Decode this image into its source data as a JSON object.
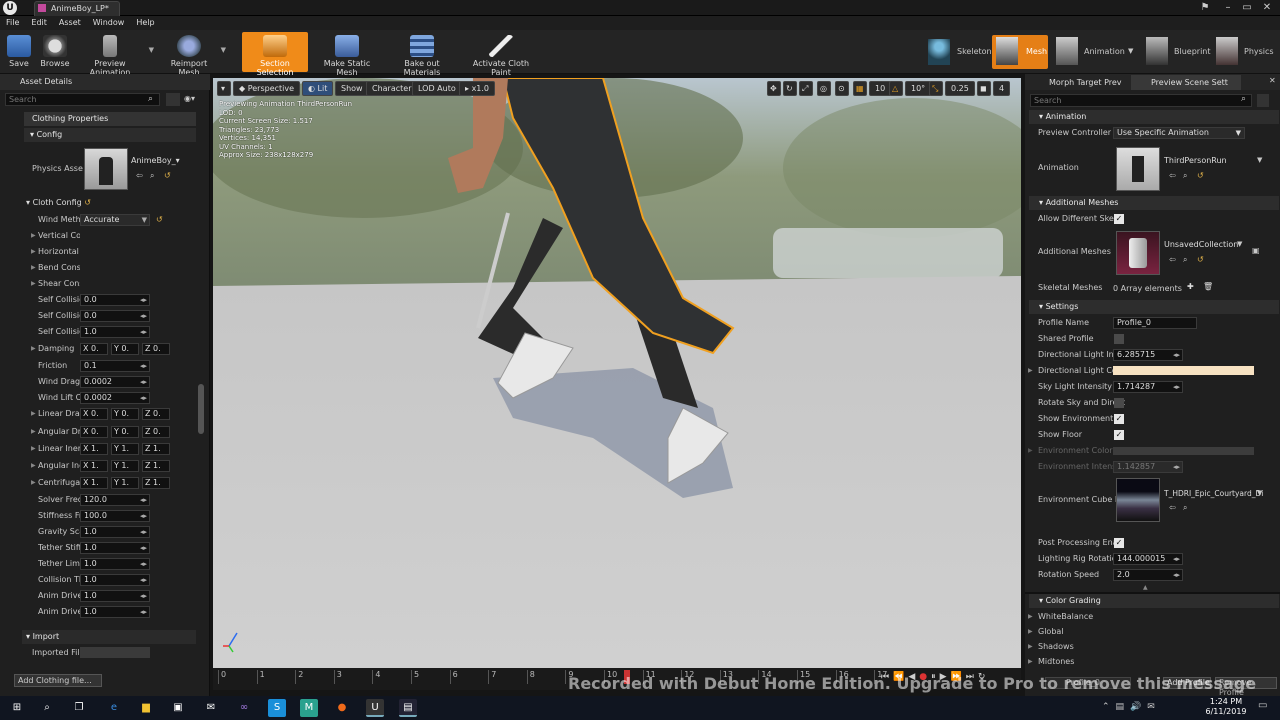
{
  "window": {
    "tab_title": "AnimeBoy_LP*"
  },
  "menu": [
    "File",
    "Edit",
    "Asset",
    "Window",
    "Help"
  ],
  "toolbar": [
    {
      "label": "Save",
      "icon": "save-icon"
    },
    {
      "label": "Browse",
      "icon": "browse-icon"
    },
    {
      "label": "Preview Animation",
      "icon": "preview-animation-icon"
    },
    {
      "label": "Reimport Mesh",
      "icon": "reimport-icon"
    },
    {
      "label": "Section Selection",
      "icon": "section-selection-icon"
    },
    {
      "label": "Make Static Mesh",
      "icon": "static-mesh-icon"
    },
    {
      "label": "Bake out Materials",
      "icon": "bake-materials-icon"
    },
    {
      "label": "Activate Cloth Paint",
      "icon": "cloth-paint-icon"
    }
  ],
  "modes": [
    "Skeleton",
    "Mesh",
    "Animation",
    "Blueprint",
    "Physics"
  ],
  "left": {
    "title": "Asset Details",
    "search_placeholder": "Search",
    "clothing_properties": "Clothing Properties",
    "config": "Config",
    "physics_asset_label": "Physics Asse",
    "physics_asset_value": "AnimeBoy_",
    "cloth_config": "Cloth Config",
    "wind_method_label": "Wind Metho",
    "wind_method_value": "Accurate",
    "collapsed": [
      "Vertical Co",
      "Horizontal C",
      "Bend Const",
      "Shear Cons"
    ],
    "self_rows": [
      {
        "label": "Self Collisic",
        "value": "0.0"
      },
      {
        "label": "Self Collisic",
        "value": "0.0"
      },
      {
        "label": "Self Collisic",
        "value": "1.0"
      }
    ],
    "damping_label": "Damping",
    "damping": [
      "X 0.",
      "Y 0.",
      "Z 0."
    ],
    "friction": {
      "label": "Friction",
      "value": "0.1"
    },
    "wind_drag": {
      "label": "Wind Drag C",
      "value": "0.0002"
    },
    "wind_lift": {
      "label": "Wind Lift Cc",
      "value": "0.0002"
    },
    "vec_rows": [
      {
        "label": "Linear Drag",
        "vals": [
          "X 0.",
          "Y 0.",
          "Z 0."
        ]
      },
      {
        "label": "Angular Dra",
        "vals": [
          "X 0.",
          "Y 0.",
          "Z 0."
        ]
      },
      {
        "label": "Linear Inert",
        "vals": [
          "X 1.",
          "Y 1.",
          "Z 1."
        ]
      },
      {
        "label": "Angular Ine",
        "vals": [
          "X 1.",
          "Y 1.",
          "Z 1."
        ]
      },
      {
        "label": "Centrifugal",
        "vals": [
          "X 1.",
          "Y 1.",
          "Z 1."
        ]
      }
    ],
    "tail_rows": [
      {
        "label": "Solver Freq",
        "value": "120.0"
      },
      {
        "label": "Stiffness Fr",
        "value": "100.0"
      },
      {
        "label": "Gravity Sca",
        "value": "1.0"
      },
      {
        "label": "Tether Stiff",
        "value": "1.0"
      },
      {
        "label": "Tether Limi",
        "value": "1.0"
      },
      {
        "label": "Collision Th",
        "value": "1.0"
      },
      {
        "label": "Anim Drive",
        "value": "1.0"
      },
      {
        "label": "Anim Drive",
        "value": "1.0"
      }
    ],
    "import": "Import",
    "imported_file": "Imported File",
    "add_clothing": "Add",
    "add_clothing_rest": "Clothing file..."
  },
  "viewport": {
    "buttons": [
      "Perspective",
      "Lit",
      "Show",
      "Character",
      "LOD Auto",
      "x1.0"
    ],
    "stats": [
      "Previewing Animation ThirdPersonRun",
      "LOD: 0",
      "Current Screen Size: 1.517",
      "Triangles: 23,773",
      "Vertices: 14,351",
      "UV Channels: 1",
      "Approx Size: 238x128x279"
    ],
    "right_vals": [
      "10",
      "10°",
      "0.25",
      "4"
    ],
    "ticks": [
      "0",
      "1",
      "2",
      "3",
      "4",
      "5",
      "6",
      "7",
      "8",
      "9",
      "10",
      "11",
      "12",
      "13",
      "14",
      "15",
      "16",
      "17"
    ]
  },
  "right": {
    "tabs": [
      "Morph Target Prev",
      "Preview Scene Sett"
    ],
    "search_placeholder": "Search",
    "animation": "Animation",
    "preview_controller_label": "Preview Controller",
    "preview_controller_value": "Use Specific Animation",
    "animation_label": "Animation",
    "animation_value": "ThirdPersonRun",
    "additional_meshes": "Additional Meshes",
    "allow_different": "Allow Different Skelel",
    "additional_meshes_label": "Additional Meshes",
    "additional_meshes_value": "UnsavedCollection",
    "skeletal_meshes": "Skeletal Meshes",
    "skeletal_meshes_value": "0 Array elements",
    "settings": "Settings",
    "profile_name": "Profile Name",
    "profile_value": "Profile_0",
    "shared_profile": "Shared Profile",
    "dir_light_int": "Directional Light Inten",
    "dir_light_int_value": "6.285715",
    "dir_light_color": "Directional Light Colo",
    "dir_light_color_hex": "#f7e2c2",
    "sky_light": "Sky Light Intensity",
    "sky_light_value": "1.714287",
    "rotate_sky": "Rotate Sky and Direct",
    "show_env": "Show Environment",
    "show_floor": "Show Floor",
    "env_color": "Environment Color",
    "env_intensity": "Environment Intensity",
    "env_intensity_value": "1.142857",
    "env_cube": "Environment Cube Ma",
    "env_cube_value": "T_HDRI_Epic_Courtyard_Di",
    "post_processing": "Post Processing Enab",
    "lighting_rig": "Lighting Rig Rotation",
    "lighting_rig_value": "144.000015",
    "rotation_speed": "Rotation Speed",
    "rotation_speed_value": "2.0",
    "color_grading": "Color Grading",
    "grading_items": [
      "WhiteBalance",
      "Global",
      "Shadows",
      "Midtones"
    ],
    "add_profile": "Add Profile",
    "remove_profile": "Remove Profile",
    "profile_dropdown": "Profile_0"
  },
  "watermark": "Recorded with Debut Home Edition. Upgrade to Pro to remove this message",
  "clock": {
    "time": "1:24 PM",
    "date": "6/11/2019"
  }
}
